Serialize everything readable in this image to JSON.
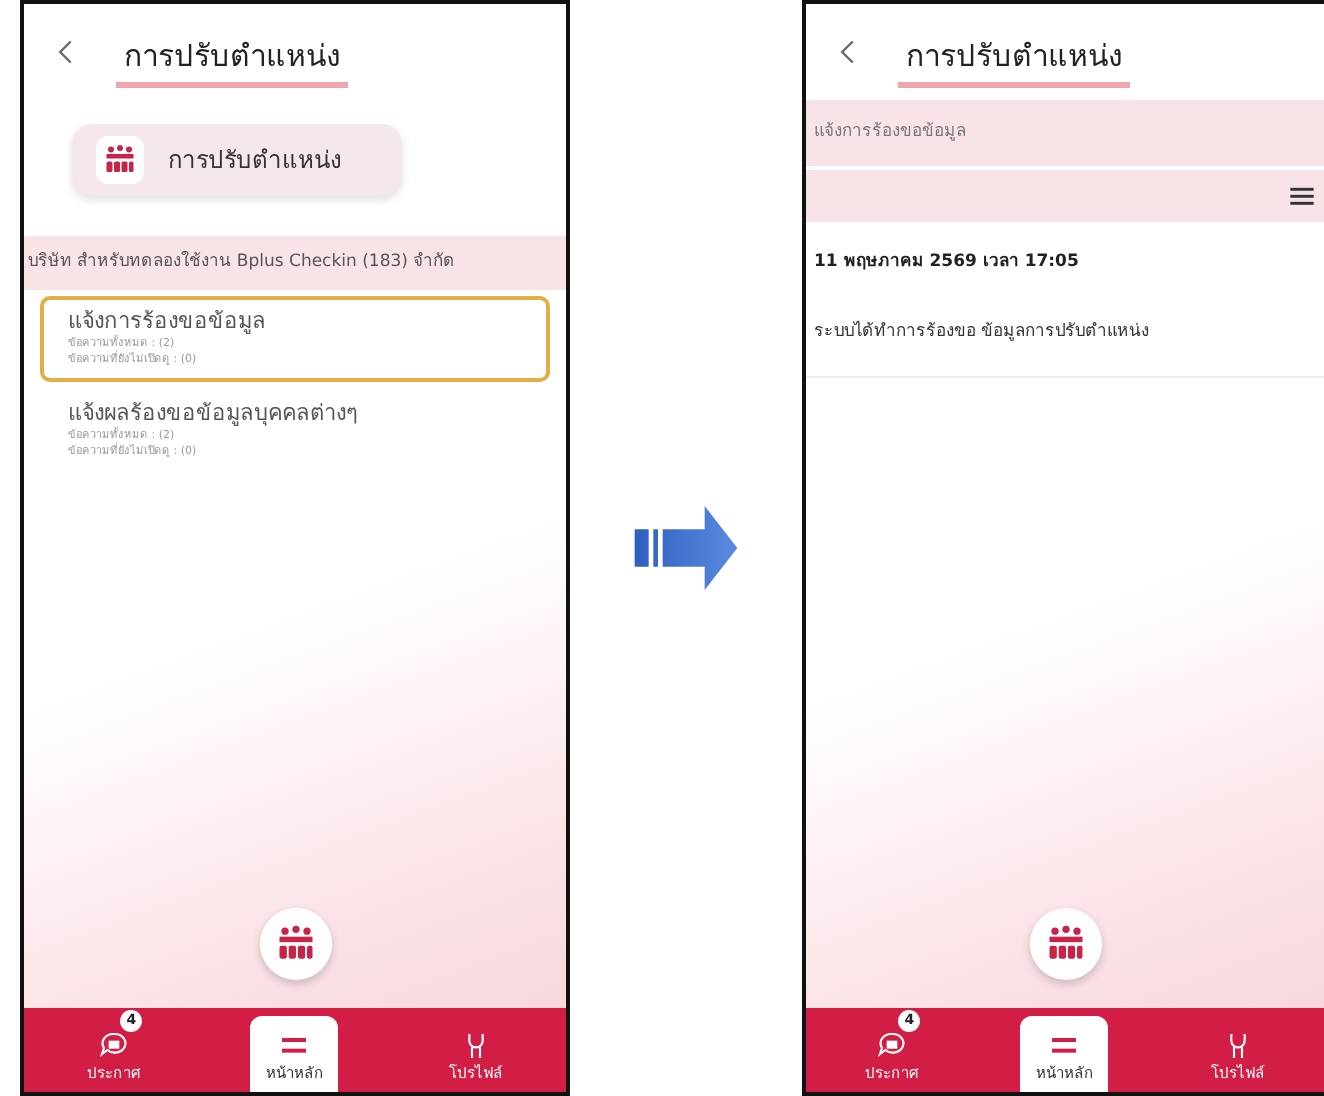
{
  "left_screen": {
    "header": {
      "title": "การปรับตำแหน่ง"
    },
    "menu_card": {
      "label": "การปรับตำแหน่ง"
    },
    "company": "บริษัท สำหรับทดลองใช้งาน Bplus Checkin (183) จำกัด",
    "items": [
      {
        "title": "แจ้งการร้องขอข้อมูล",
        "total": "ข้อความทั้งหมด : (2)",
        "unread": "ข้อความที่ยังไม่เปิดดู : (0)",
        "selected": true
      },
      {
        "title": "แจ้งผลร้องขอข้อมูลบุคคลต่างๆ",
        "total": "ข้อความทั้งหมด : (2)",
        "unread": "ข้อความที่ยังไม่เปิดดู : (0)",
        "selected": false
      }
    ],
    "bottom_nav": [
      {
        "label": "ประกาศ",
        "kind": "announce",
        "badge": "4",
        "selected": false
      },
      {
        "label": "หน้าหลัก",
        "kind": "home",
        "selected": true
      },
      {
        "label": "โปรไฟล์",
        "kind": "profile",
        "selected": false
      }
    ]
  },
  "right_screen": {
    "header": {
      "title": "การปรับตำแหน่ง"
    },
    "section_title": "แจ้งการร้องขอข้อมูล",
    "date": "11 พฤษภาคม 2569 เวลา 17:05",
    "message": "ระบบได้ทำการร้องขอ ข้อมูลการปรับตำแหน่ง",
    "bottom_nav": [
      {
        "label": "ประกาศ",
        "kind": "announce",
        "badge": "4",
        "selected": false
      },
      {
        "label": "หน้าหลัก",
        "kind": "home",
        "selected": true
      },
      {
        "label": "โปรไฟล์",
        "kind": "profile",
        "selected": false
      }
    ]
  }
}
